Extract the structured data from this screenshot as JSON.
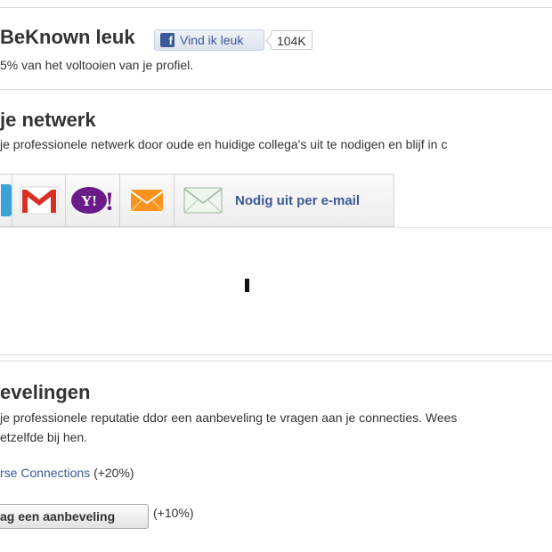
{
  "like_section": {
    "title": "BeKnown leuk",
    "like_button_label": "Vind ik leuk",
    "like_count": "104K",
    "subtitle": "5% van het voltooien van je profiel."
  },
  "network_section": {
    "title": "je netwerk",
    "subtitle": "je professionele netwerk door oude en huidige collega's uit te nodigen en blijf in c",
    "providers": {
      "email_label": "Nodig uit per e-mail"
    }
  },
  "recommend_section": {
    "title": "evelingen",
    "subtitle_line1": "je professionele reputatie ddor een aanbeveling te vragen aan je connecties. Wees",
    "subtitle_line2": "etzelfde bij hen.",
    "connections_link": "rse Connections",
    "connections_bonus": "(+20%)",
    "ask_button_label": "ag een aanbeveling",
    "ask_bonus": "(+10%)"
  },
  "colors": {
    "link": "#3b5998",
    "facebook": "#3b5998",
    "divider": "#dcdcdc"
  }
}
